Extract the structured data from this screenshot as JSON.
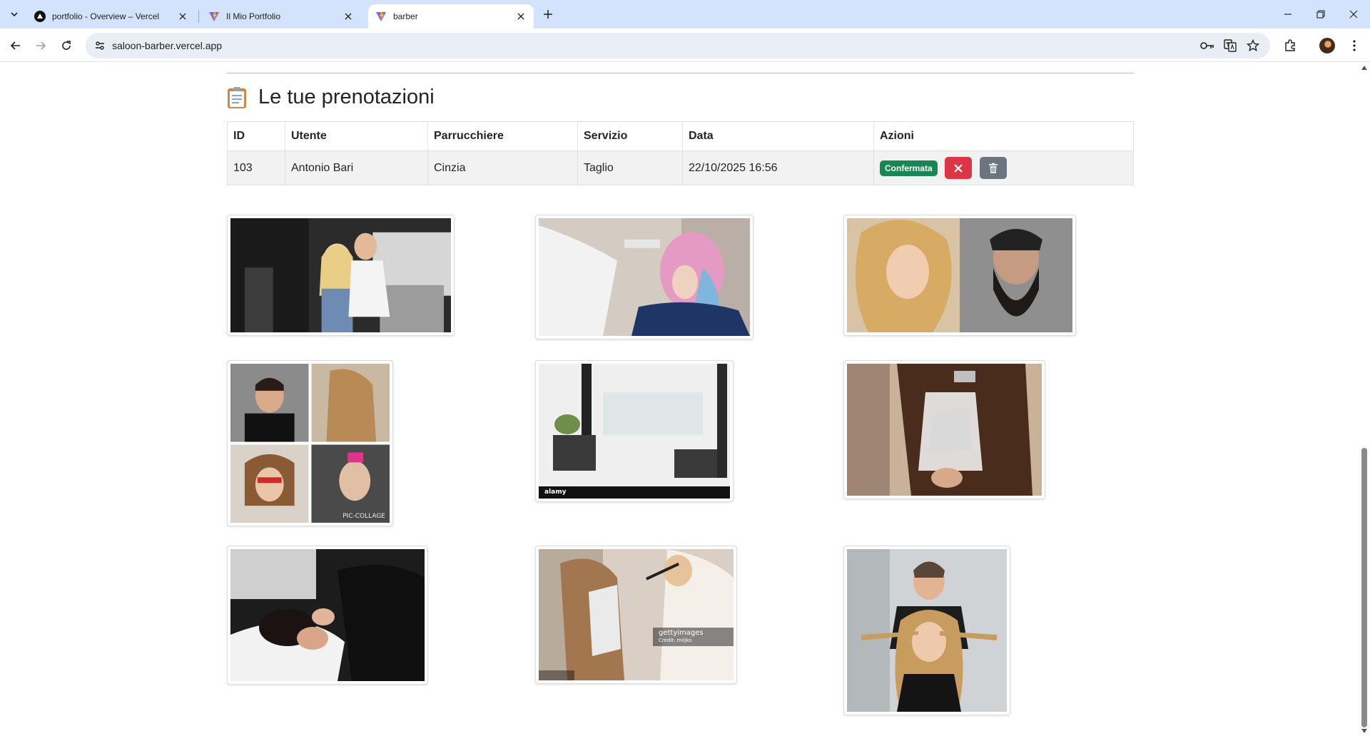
{
  "browser": {
    "tabs": [
      {
        "title": "portfolio - Overview – Vercel",
        "favicon": "vercel-icon",
        "active": false
      },
      {
        "title": "Il Mio Portfolio",
        "favicon": "vite-icon",
        "active": false
      },
      {
        "title": "barber",
        "favicon": "vite-icon",
        "active": true
      }
    ],
    "url": "saloon-barber.vercel.app"
  },
  "page": {
    "section_title": "Le tue prenotazioni",
    "table": {
      "headers": [
        "ID",
        "Utente",
        "Parrucchiere",
        "Servizio",
        "Data",
        "Azioni"
      ],
      "rows": [
        {
          "id": "103",
          "utente": "Antonio Bari",
          "parrucchiere": "Cinzia",
          "servizio": "Taglio",
          "data": "22/10/2025 16:56",
          "status": "Confermata"
        }
      ]
    },
    "gallery": [
      {
        "name": "salon-consultation-photo"
      },
      {
        "name": "hair-coloring-pink-photo"
      },
      {
        "name": "curly-hair-and-beard-photo"
      },
      {
        "name": "haircut-collage-photo",
        "watermark": "PIC-COLLAGE"
      },
      {
        "name": "salon-interior-photo",
        "watermark": "alamy"
      },
      {
        "name": "foil-highlights-photo"
      },
      {
        "name": "hair-wash-photo"
      },
      {
        "name": "hair-dye-brush-photo",
        "watermark": "gettyimages",
        "credit": "Credit: miljko"
      },
      {
        "name": "stylist-and-client-photo"
      }
    ]
  },
  "colors": {
    "tabbar_bg": "#d3e3fd",
    "badge_success": "#198754",
    "btn_danger": "#dc3545",
    "btn_secondary": "#6c757d"
  }
}
